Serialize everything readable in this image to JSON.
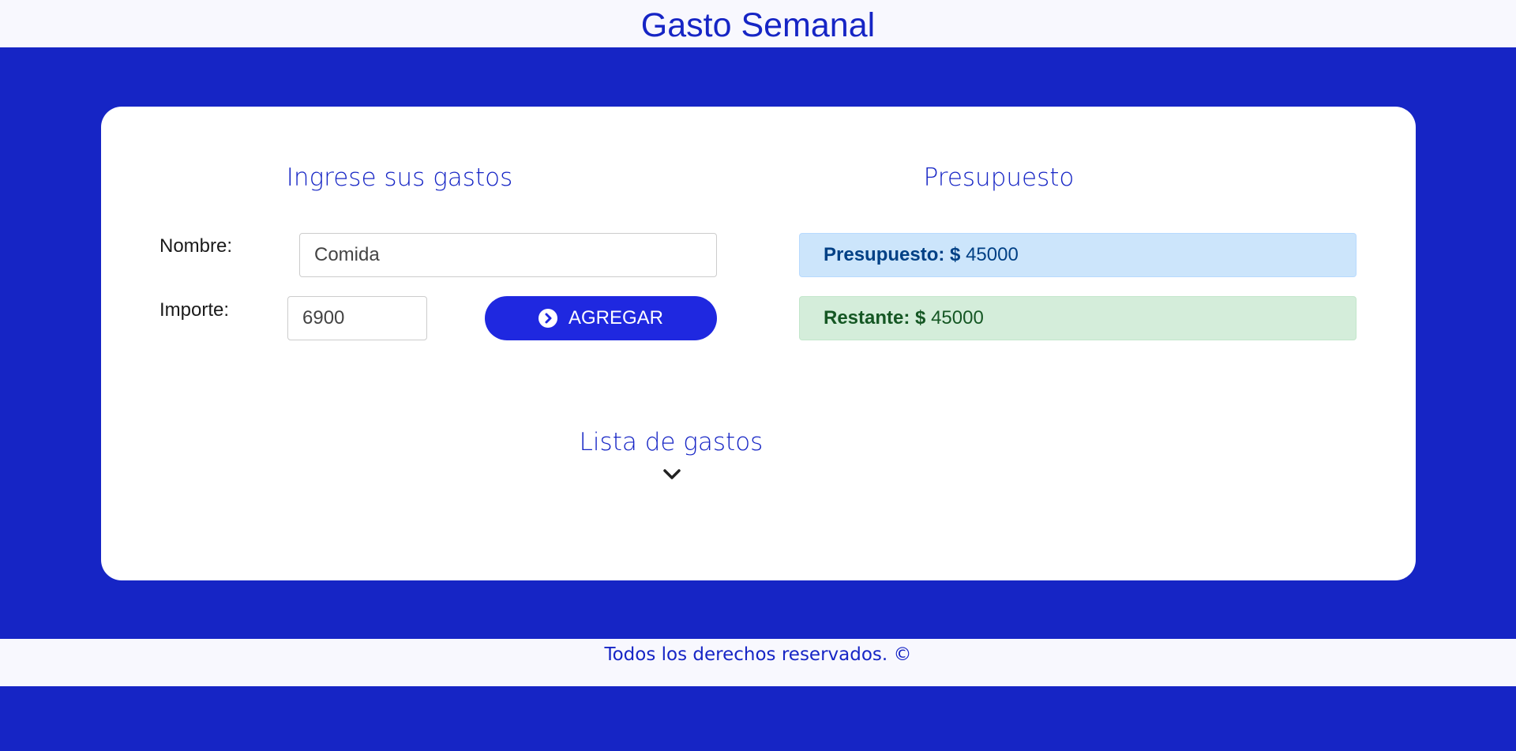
{
  "header": {
    "title": "Gasto Semanal"
  },
  "form": {
    "title": "Ingrese sus gastos",
    "name_label": "Nombre:",
    "name_value": "Comida",
    "amount_label": "Importe:",
    "amount_value": "6900",
    "add_button_label": "AGREGAR",
    "add_button_icon": "chevron-circle-right-icon"
  },
  "budget": {
    "title": "Presupuesto",
    "budget_label": "Presupuesto:",
    "budget_currency": "$",
    "budget_value": "45000",
    "remaining_label": "Restante:",
    "remaining_currency": "$",
    "remaining_value": "45000"
  },
  "expenses": {
    "title": "Lista de gastos",
    "toggle_icon": "chevron-down-icon"
  },
  "footer": {
    "text": "Todos los derechos reservados. ©"
  },
  "colors": {
    "brand": "#1625c5",
    "button": "#1f28e0",
    "info_bg": "#cce5fb",
    "success_bg": "#d4edda"
  }
}
